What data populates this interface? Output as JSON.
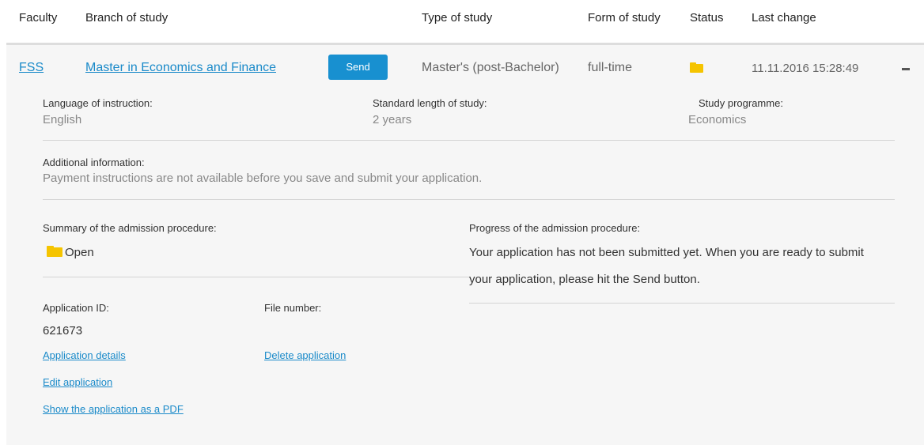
{
  "header": {
    "faculty": "Faculty",
    "branch": "Branch of study",
    "type": "Type of study",
    "form": "Form of study",
    "status": "Status",
    "last_change": "Last change"
  },
  "row": {
    "faculty": "FSS",
    "branch": "Master in Economics and Finance",
    "send_label": "Send",
    "type": "Master's (post-Bachelor)",
    "form": "full-time",
    "status_icon": "folder-icon",
    "last_change": "11.11.2016 15:28:49",
    "collapse_icon": "minus-icon"
  },
  "details": {
    "language_label": "Language of instruction:",
    "language_value": "English",
    "length_label": "Standard length of study:",
    "length_value": "2 years",
    "programme_label": "Study programme:",
    "programme_value": "Economics",
    "additional_label": "Additional information:",
    "additional_value": "Payment instructions are not available before you save and submit your application.",
    "summary_label": "Summary of the admission procedure:",
    "summary_value": "Open",
    "progress_label": "Progress of the admission procedure:",
    "progress_line1": "Your application has not been submitted yet. When you are ready to submit",
    "progress_line2": "your application, please hit the Send button.",
    "app_id_label": "Application ID:",
    "app_id_value": "621673",
    "file_number_label": "File number:",
    "app_details_link": "Application details",
    "delete_link": "Delete application",
    "edit_link": "Edit application",
    "pdf_link": "Show the application as a PDF"
  },
  "colors": {
    "accent": "#1890d0",
    "link": "#1a8ac9",
    "folder": "#f5c400",
    "panel_bg": "#f6f6f6"
  }
}
